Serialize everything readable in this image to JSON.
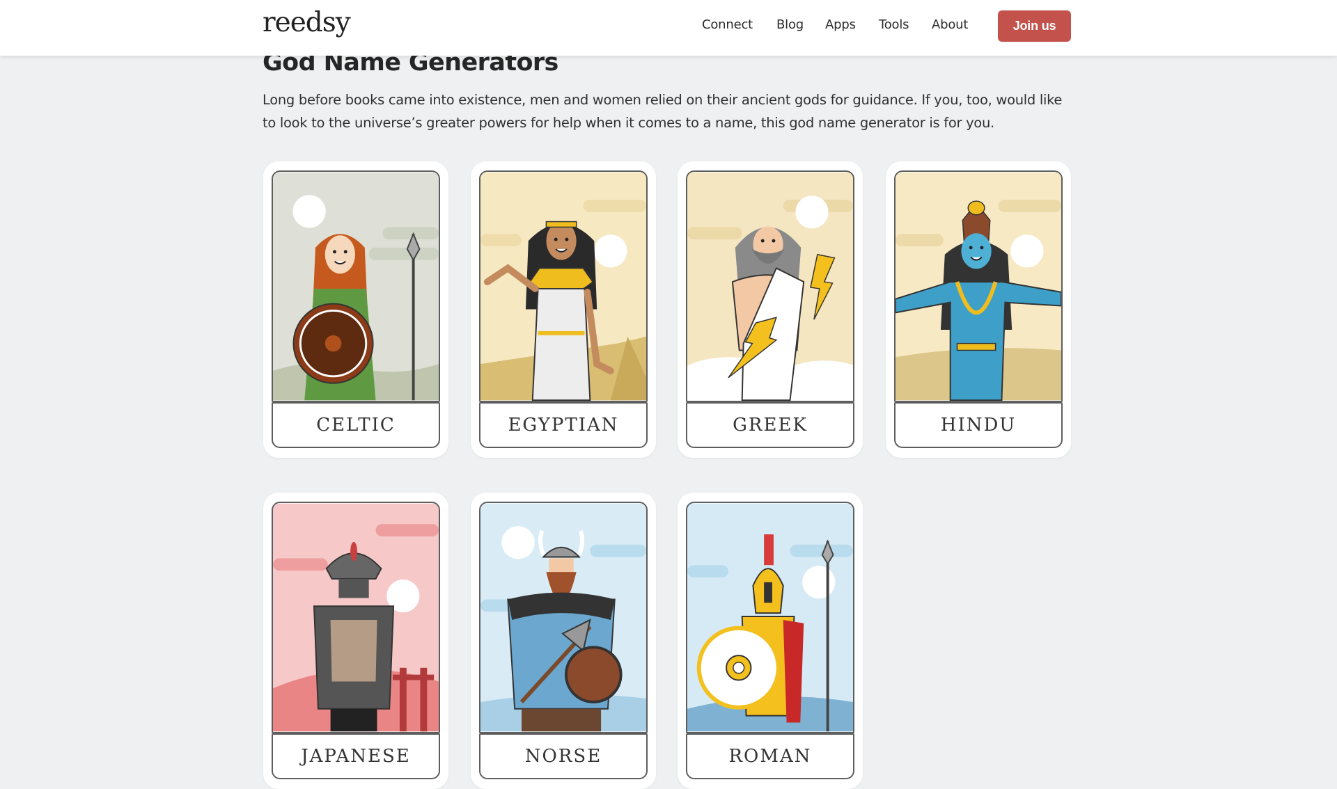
{
  "header": {
    "logo": "reedsy",
    "nav": [
      "Connect",
      "Blog",
      "Apps",
      "Tools",
      "About"
    ],
    "cta": "Join us",
    "cta_color": "#c2524b"
  },
  "main": {
    "title": "God Name Generators",
    "intro": "Long before books came into existence, men and women relied on their ancient gods for guidance. If you, too, would like to look to the universe’s greater powers for help when it comes to a name, this god name generator is for you.",
    "cards": [
      {
        "label": "CELTIC",
        "illustration": "celtic-goddess-with-shield-and-spear",
        "bg": "#dedfd6"
      },
      {
        "label": "EGYPTIAN",
        "illustration": "egyptian-goddess",
        "bg": "#f6e9c2"
      },
      {
        "label": "GREEK",
        "illustration": "zeus-with-lightning-bolts",
        "bg": "#f5e6c2"
      },
      {
        "label": "HINDU",
        "illustration": "blue-hindu-deity-dancing",
        "bg": "#f6e9c4"
      },
      {
        "label": "JAPANESE",
        "illustration": "samurai-with-torii-gate",
        "bg": "#f6c8c8"
      },
      {
        "label": "NORSE",
        "illustration": "viking-with-axe-and-shield",
        "bg": "#d9ecf6"
      },
      {
        "label": "ROMAN",
        "illustration": "roman-soldier-with-shield-and-spear",
        "bg": "#d6eaf5"
      }
    ]
  }
}
